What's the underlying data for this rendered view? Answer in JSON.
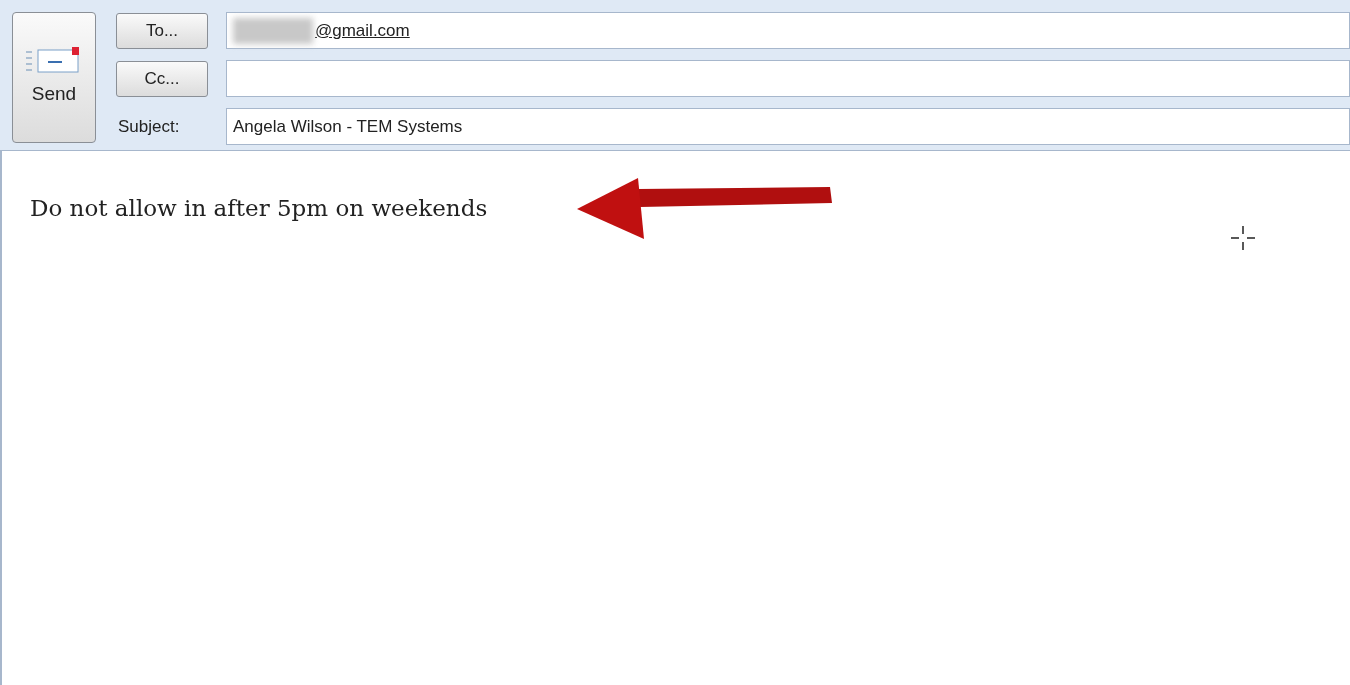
{
  "send_button": {
    "label": "Send"
  },
  "recipients": [
    {
      "button": "To...",
      "value": "@gmail.com",
      "redacted": true
    },
    {
      "button": "Cc..."
    }
  ],
  "subject": {
    "label": "Subject:",
    "value": "Angela Wilson - TEM Systems"
  },
  "body": {
    "text": "Do not allow in after 5pm on weekends"
  }
}
